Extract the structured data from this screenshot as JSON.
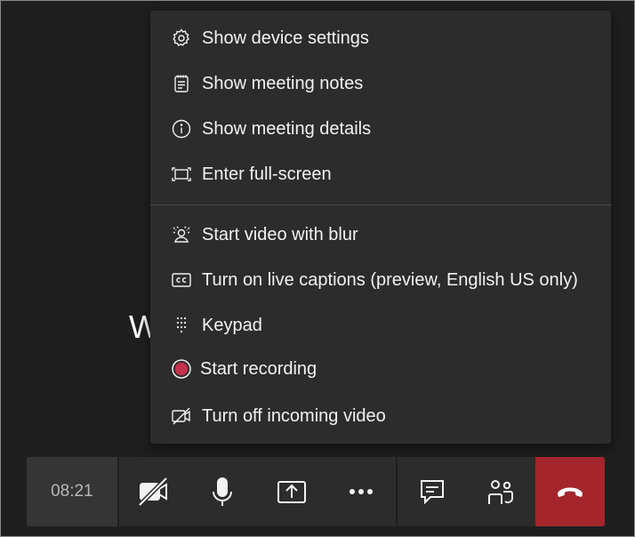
{
  "background": {
    "partial_text": "W"
  },
  "menu": {
    "items": [
      {
        "label": "Show device settings",
        "icon": "gear-icon"
      },
      {
        "label": "Show meeting notes",
        "icon": "notes-icon"
      },
      {
        "label": "Show meeting details",
        "icon": "info-icon"
      },
      {
        "label": "Enter full-screen",
        "icon": "fullscreen-icon"
      },
      {
        "label": "Start video with blur",
        "icon": "blur-icon"
      },
      {
        "label": "Turn on live captions (preview, English US only)",
        "icon": "cc-icon"
      },
      {
        "label": "Keypad",
        "icon": "keypad-icon"
      },
      {
        "label": "Start recording",
        "icon": "record-icon"
      },
      {
        "label": "Turn off incoming video",
        "icon": "video-off-icon"
      }
    ]
  },
  "toolbar": {
    "timer": "08:21",
    "buttons": [
      "camera-off-icon",
      "microphone-icon",
      "share-screen-icon",
      "more-icon",
      "chat-icon",
      "people-icon",
      "hang-up-icon"
    ]
  },
  "colors": {
    "menu_bg": "#2d2c2c",
    "hangup": "#a4262c",
    "record_dot": "#c4314b"
  }
}
